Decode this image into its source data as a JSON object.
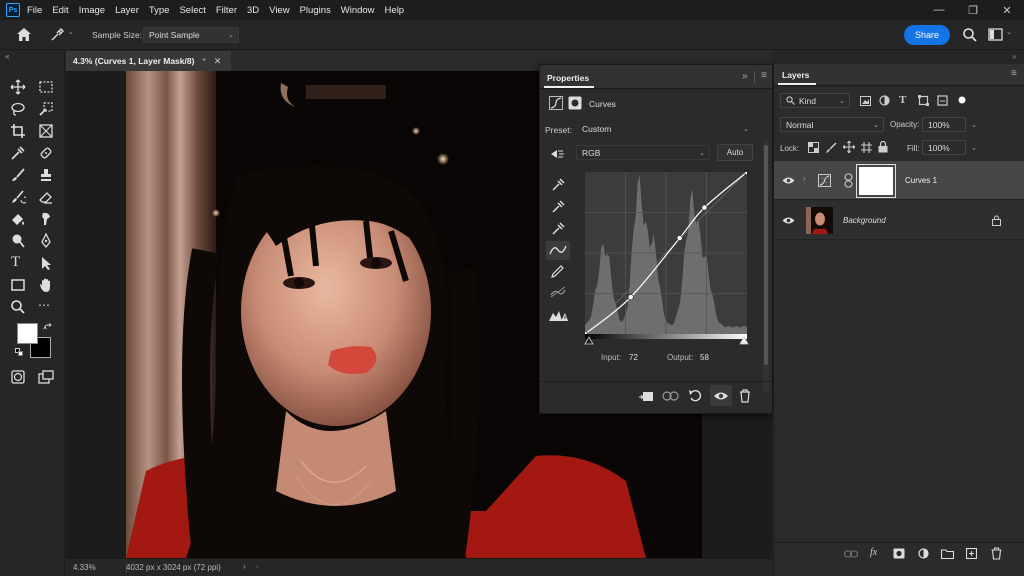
{
  "menubar": {
    "logo": "Ps",
    "items": [
      "File",
      "Edit",
      "Image",
      "Layer",
      "Type",
      "Select",
      "Filter",
      "3D",
      "View",
      "Plugins",
      "Window",
      "Help"
    ]
  },
  "options": {
    "sample_size_label": "Sample Size:",
    "sample_size_value": "Point Sample",
    "share_label": "Share"
  },
  "document": {
    "tab_title": "4.3% (Curves 1, Layer Mask/8)",
    "tab_modified": "*",
    "zoom": "4.33%",
    "dimensions": "4032 px x 3024 px (72 ppi)"
  },
  "properties": {
    "title": "Properties",
    "adjustment_title": "Curves",
    "preset_label": "Preset:",
    "preset_value": "Custom",
    "channel_value": "RGB",
    "auto_label": "Auto",
    "input_label": "Input:",
    "input_value": "72",
    "output_label": "Output:",
    "output_value": "58"
  },
  "layers_panel": {
    "title": "Layers",
    "filter_value": "Kind",
    "blend_mode": "Normal",
    "opacity_label": "Opacity:",
    "opacity_value": "100%",
    "lock_label": "Lock:",
    "fill_label": "Fill:",
    "fill_value": "100%",
    "layers": [
      {
        "name": "Curves 1"
      },
      {
        "name": "Background"
      }
    ]
  },
  "colors": {
    "accent": "#1473e6",
    "panel": "#2b2b2b",
    "header": "#323232"
  }
}
